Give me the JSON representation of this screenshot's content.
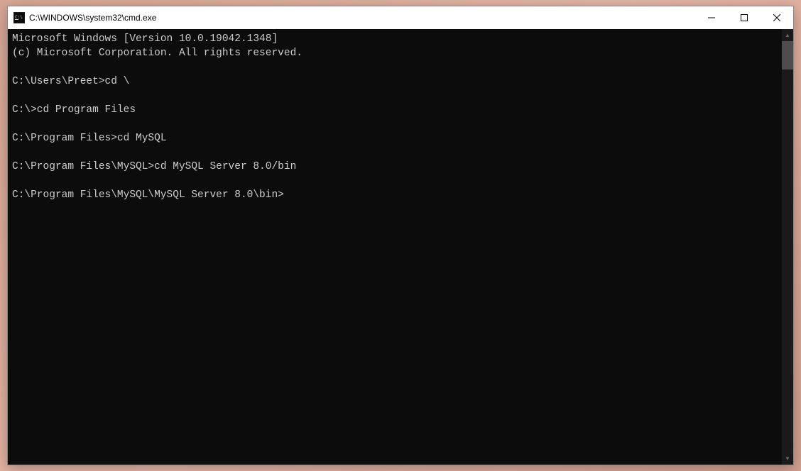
{
  "window": {
    "title": "C:\\WINDOWS\\system32\\cmd.exe"
  },
  "terminal": {
    "lines": [
      "Microsoft Windows [Version 10.0.19042.1348]",
      "(c) Microsoft Corporation. All rights reserved.",
      "",
      "C:\\Users\\Preet>cd \\",
      "",
      "C:\\>cd Program Files",
      "",
      "C:\\Program Files>cd MySQL",
      "",
      "C:\\Program Files\\MySQL>cd MySQL Server 8.0/bin",
      "",
      "C:\\Program Files\\MySQL\\MySQL Server 8.0\\bin>"
    ]
  }
}
